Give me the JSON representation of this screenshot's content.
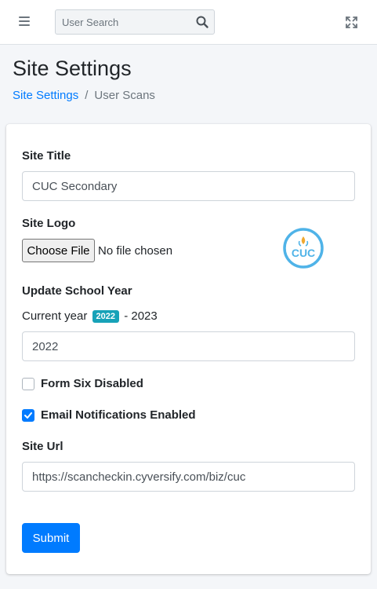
{
  "header": {
    "menu_icon": "hamburger-icon",
    "search": {
      "placeholder": "User Search",
      "value": "",
      "icon": "search-icon"
    },
    "fullscreen_icon": "expand-icon"
  },
  "page": {
    "title": "Site Settings",
    "breadcrumb": [
      {
        "label": "Site Settings",
        "link": true
      },
      {
        "label": "User Scans",
        "link": false
      }
    ],
    "breadcrumb_separator": "/"
  },
  "form": {
    "site_title": {
      "label": "Site Title",
      "value": "CUC Secondary"
    },
    "site_logo": {
      "label": "Site Logo",
      "button_label": "Choose File",
      "status": "No file chosen",
      "logo_text": "CUC",
      "logo_color": "#4fb3e8"
    },
    "school_year": {
      "label": "Update School Year",
      "current_prefix": "Current year",
      "badge": "2022",
      "suffix": "- 2023",
      "value": "2022"
    },
    "form_six": {
      "label": "Form Six Disabled",
      "checked": false
    },
    "email_notifications": {
      "label": "Email Notifications Enabled",
      "checked": true
    },
    "site_url": {
      "label": "Site Url",
      "value": "https://scancheckin.cyversify.com/biz/cuc"
    },
    "submit_label": "Submit"
  },
  "colors": {
    "primary": "#007bff",
    "badge": "#17a2b8",
    "background": "#f4f6f9"
  }
}
